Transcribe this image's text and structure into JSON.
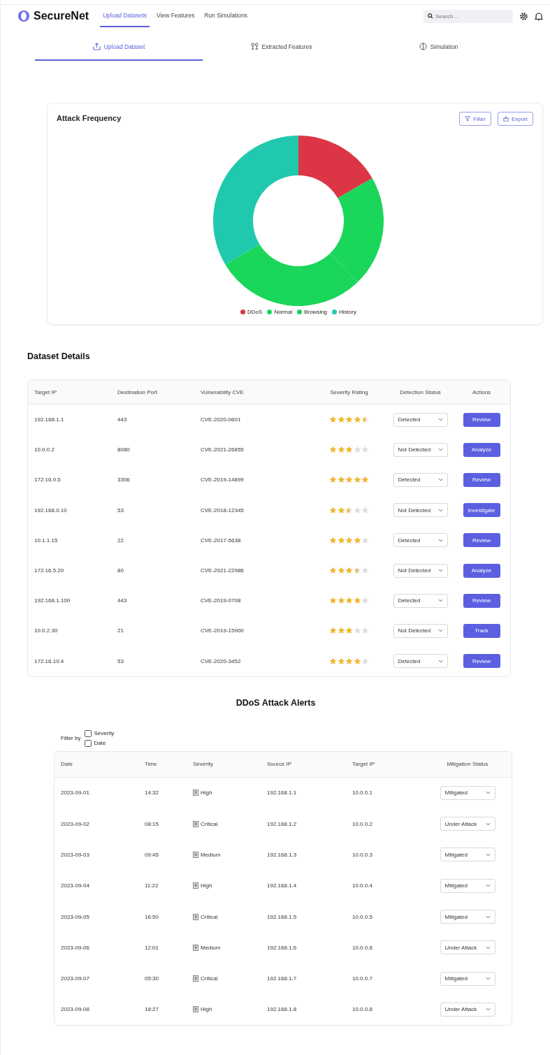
{
  "brand": "SecureNet",
  "nav": [
    {
      "label": "Upload Datasets",
      "selected": true
    },
    {
      "label": "View Features",
      "selected": false
    },
    {
      "label": "Run Simulations",
      "selected": false
    }
  ],
  "search": {
    "placeholder": "Search ..."
  },
  "tabs": [
    {
      "label": "Upload Dataset",
      "selected": true
    },
    {
      "label": "Extracted Features",
      "selected": false
    },
    {
      "label": "Simulation",
      "selected": false
    }
  ],
  "chart_card": {
    "title": "Attack Frequency",
    "buttons": [
      "Filter",
      "Export"
    ],
    "legend": [
      {
        "label": "DDoS",
        "color": "#dc3545"
      },
      {
        "label": "Normal",
        "color": "#1ad65a"
      },
      {
        "label": "Browsing",
        "color": "#1ad65a"
      },
      {
        "label": "History",
        "color": "#20c9ad"
      }
    ]
  },
  "dataset": {
    "title": "Dataset Details",
    "columns": [
      "Target IP",
      "Destination Port",
      "Vulnerability CVE",
      "Severity Rating",
      "Detection Status",
      "Actions"
    ],
    "rows": [
      {
        "ip": "192.168.1.1",
        "port": "443",
        "cve": "CVE-2020-0601",
        "stars": 4.5,
        "status": "Detected",
        "action": "Review"
      },
      {
        "ip": "10.0.0.2",
        "port": "8080",
        "cve": "CVE-2021-26855",
        "stars": 3,
        "status": "Not Detected",
        "action": "Analyze"
      },
      {
        "ip": "172.16.0.5",
        "port": "3306",
        "cve": "CVE-2019-14899",
        "stars": 5,
        "status": "Detected",
        "action": "Review"
      },
      {
        "ip": "192.168.0.10",
        "port": "53",
        "cve": "CVE-2018-12345",
        "stars": 2.5,
        "status": "Not Detected",
        "action": "Investigate"
      },
      {
        "ip": "10.1.1.15",
        "port": "22",
        "cve": "CVE-2017-5638",
        "stars": 4,
        "status": "Detected",
        "action": "Review"
      },
      {
        "ip": "172.16.5.20",
        "port": "80",
        "cve": "CVE-2021-22986",
        "stars": 3.5,
        "status": "Not Detected",
        "action": "Analyze"
      },
      {
        "ip": "192.168.1.100",
        "port": "443",
        "cve": "CVE-2019-0708",
        "stars": 4,
        "status": "Detected",
        "action": "Review"
      },
      {
        "ip": "10.0.2.30",
        "port": "21",
        "cve": "CVE-2019-15900",
        "stars": 3,
        "status": "Not Detected",
        "action": "Track"
      },
      {
        "ip": "172.16.10.4",
        "port": "53",
        "cve": "CVE-2020-3452",
        "stars": 4,
        "status": "Detected",
        "action": "Review"
      }
    ]
  },
  "alerts": {
    "title": "DDoS Attack Alerts",
    "filter_label": "Filter by",
    "filters": [
      {
        "label": "Severity",
        "checked": false
      },
      {
        "label": "Date",
        "checked": false
      }
    ],
    "columns": [
      "Date",
      "Time",
      "Severity",
      "Source IP",
      "Target IP",
      "Mitigation Status"
    ],
    "rows": [
      {
        "date": "2023-09-01",
        "time": "14:32",
        "severity": "High",
        "source": "192.168.1.1",
        "target": "10.0.0.1",
        "status": "Mitigated"
      },
      {
        "date": "2023-09-02",
        "time": "08:15",
        "severity": "Critical",
        "source": "192.168.1.2",
        "target": "10.0.0.2",
        "status": "Under Attack"
      },
      {
        "date": "2023-09-03",
        "time": "09:45",
        "severity": "Medium",
        "source": "192.168.1.3",
        "target": "10.0.0.3",
        "status": "Mitigated"
      },
      {
        "date": "2023-09-04",
        "time": "11:22",
        "severity": "High",
        "source": "192.168.1.4",
        "target": "10.0.0.4",
        "status": "Mitigated"
      },
      {
        "date": "2023-09-05",
        "time": "16:50",
        "severity": "Critical",
        "source": "192.168.1.5",
        "target": "10.0.0.5",
        "status": "Mitigated"
      },
      {
        "date": "2023-09-06",
        "time": "12:01",
        "severity": "Medium",
        "source": "192.168.1.6",
        "target": "10.0.0.6",
        "status": "Under Attack"
      },
      {
        "date": "2023-09-07",
        "time": "05:30",
        "severity": "Critical",
        "source": "192.168.1.7",
        "target": "10.0.0.7",
        "status": "Mitigated"
      },
      {
        "date": "2023-09-08",
        "time": "18:27",
        "severity": "High",
        "source": "192.168.1.8",
        "target": "10.0.0.8",
        "status": "Under Attack"
      }
    ]
  }
}
